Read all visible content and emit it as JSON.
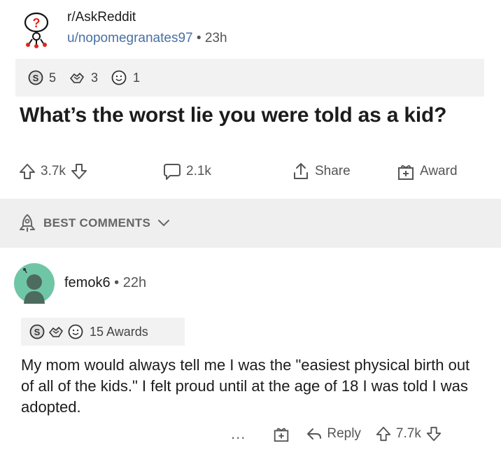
{
  "post": {
    "subreddit": "r/AskReddit",
    "author": "u/nopomegranates97",
    "separator": "•",
    "time": "23h",
    "awards": [
      {
        "icon": "silver-award-icon",
        "count": "5"
      },
      {
        "icon": "helpful-award-icon",
        "count": "3"
      },
      {
        "icon": "wholesome-award-icon",
        "count": "1"
      }
    ],
    "title": "What’s the worst lie you were told as a kid?",
    "actions": {
      "upvotes": "3.7k",
      "comments": "2.1k",
      "share": "Share",
      "award": "Award"
    }
  },
  "sort": {
    "label": "BEST COMMENTS"
  },
  "comment": {
    "author": "femok6",
    "separator": "•",
    "time": "22h",
    "awards_label": "15 Awards",
    "body": "My mom would always tell me I was the \"easiest physical birth out of all of the kids.\" I felt proud until at the age of 18 I was told I was adopted.",
    "actions": {
      "more": "...",
      "reply": "Reply",
      "votes": "7.7k"
    }
  },
  "colors": {
    "author_link": "#4a6fa5",
    "award_bar": "#f2f2f2",
    "sort_bar": "#efefef",
    "comment_avatar": "#6fc6a6"
  }
}
